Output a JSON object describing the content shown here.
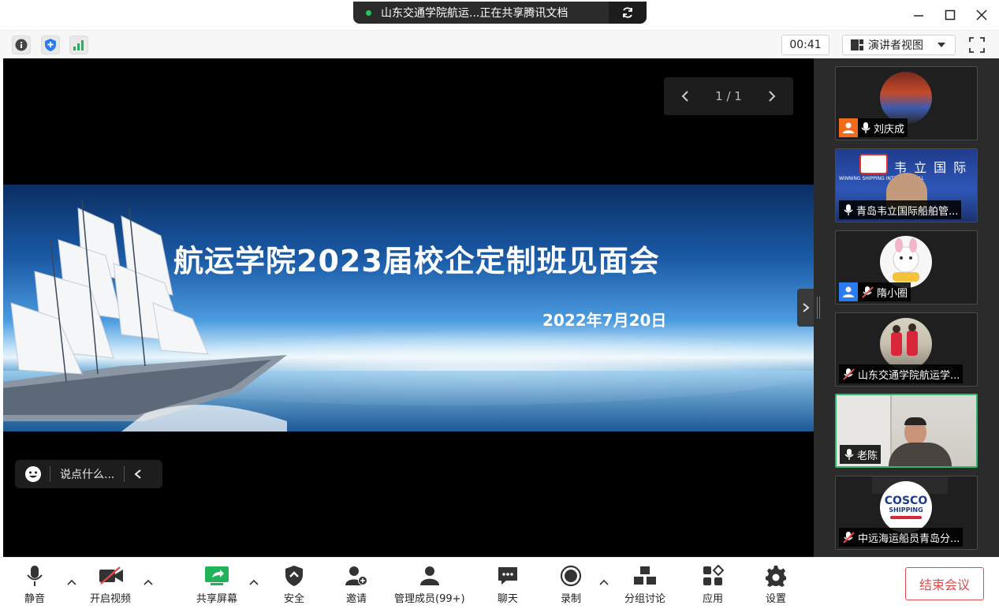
{
  "titlebar": {
    "share_text": "山东交通学院航运...正在共享腾讯文档"
  },
  "infobar": {
    "timer": "00:41",
    "view_mode": "演讲者视图"
  },
  "stage": {
    "page_indicator": "1 / 1",
    "slide_title": "航运学院2023届校企定制班见面会",
    "slide_date": "2022年7月20日",
    "chat_placeholder": "说点什么..."
  },
  "participants": [
    {
      "name": "刘庆成",
      "host": true,
      "host_color": "#f26b1d",
      "muted": false
    },
    {
      "name": "青岛韦立国际船舶管...",
      "host": false,
      "muted": false,
      "banner_text": "韦 立 国 际",
      "banner_sub": "WINNING SHIPPING INTERNATIONAL"
    },
    {
      "name": "隋小圈",
      "host": true,
      "host_color": "#2b7cf0",
      "muted": true
    },
    {
      "name": "山东交通学院航运学...",
      "host": false,
      "muted": true
    },
    {
      "name": "老陈",
      "host": false,
      "muted": false,
      "active": true
    },
    {
      "name": "中远海运船员青岛分...",
      "host": false,
      "muted": true,
      "logo_text": "COSCO",
      "logo_sub": "SHIPPING"
    }
  ],
  "toolbar": {
    "mute": "静音",
    "video": "开启视频",
    "share": "共享屏幕",
    "security": "安全",
    "invite": "邀请",
    "members": "管理成员(99+)",
    "chat": "聊天",
    "record": "录制",
    "breakout": "分组讨论",
    "apps": "应用",
    "settings": "设置",
    "end": "结束会议"
  },
  "colors": {
    "accent_green": "#2fb86a",
    "end_red": "#e24b4b",
    "share_green": "#1ec85a"
  }
}
